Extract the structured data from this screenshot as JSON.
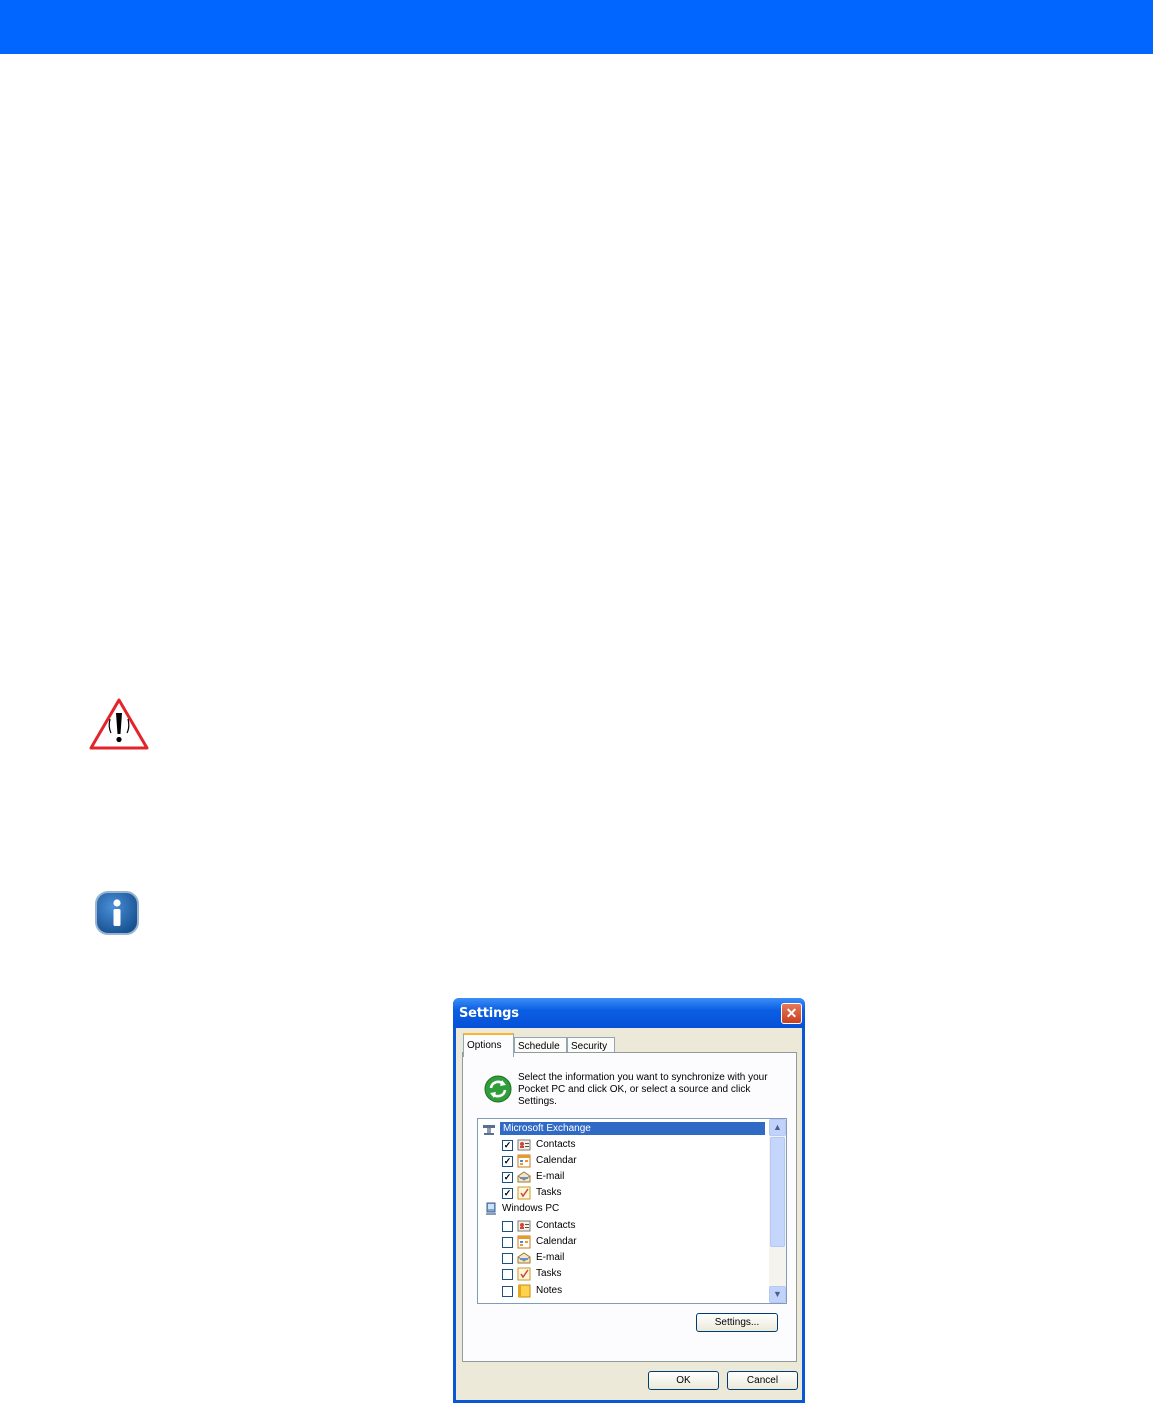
{
  "dialog": {
    "title": "Settings",
    "close_glyph": "✕",
    "tabs": [
      {
        "label": "Options",
        "active": true
      },
      {
        "label": "Schedule",
        "active": false
      },
      {
        "label": "Security",
        "active": false
      }
    ],
    "description": "Select the information you want to synchronize with your Pocket PC and click OK, or select a source and click Settings.",
    "groups": [
      {
        "name": "Microsoft Exchange",
        "icon": "exchange-server-icon",
        "selected": true,
        "items": [
          {
            "label": "Contacts",
            "checked": true,
            "icon": "contacts-icon"
          },
          {
            "label": "Calendar",
            "checked": true,
            "icon": "calendar-icon"
          },
          {
            "label": "E-mail",
            "checked": true,
            "icon": "email-icon"
          },
          {
            "label": "Tasks",
            "checked": true,
            "icon": "tasks-icon"
          }
        ]
      },
      {
        "name": "Windows PC",
        "icon": "windows-pc-icon",
        "selected": false,
        "items": [
          {
            "label": "Contacts",
            "checked": false,
            "icon": "contacts-icon"
          },
          {
            "label": "Calendar",
            "checked": false,
            "icon": "calendar-icon"
          },
          {
            "label": "E-mail",
            "checked": false,
            "icon": "email-icon"
          },
          {
            "label": "Tasks",
            "checked": false,
            "icon": "tasks-icon"
          },
          {
            "label": "Notes",
            "checked": false,
            "icon": "notes-icon"
          }
        ]
      }
    ],
    "settings_button": "Settings...",
    "ok_button": "OK",
    "cancel_button": "Cancel"
  },
  "colors": {
    "header_bar": "#0066ff",
    "warning_red": "#e3242b",
    "info_blue": "#1f5fa8",
    "selection": "#316ac5"
  }
}
